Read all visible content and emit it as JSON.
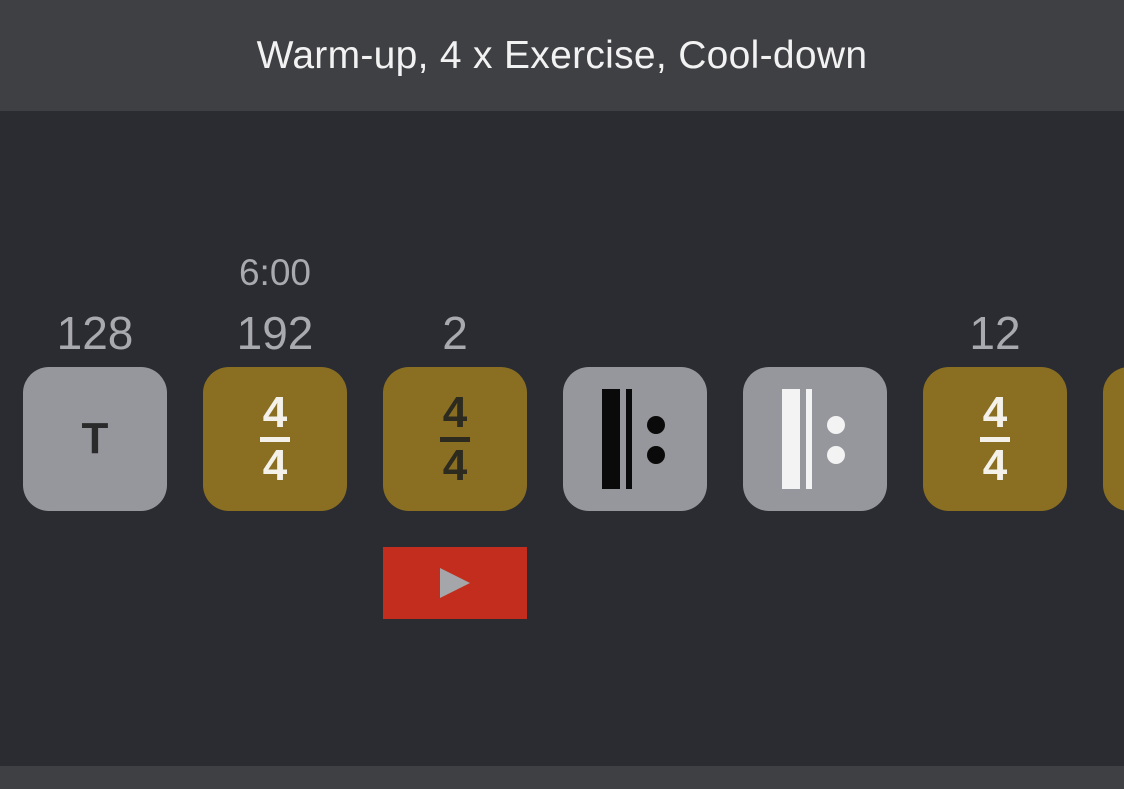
{
  "header": {
    "title": "Warm-up, 4 x Exercise, Cool-down"
  },
  "timeline": {
    "items": [
      {
        "label": "128",
        "type": "tempo",
        "symbol": "T"
      },
      {
        "label": "192",
        "time": "6:00",
        "type": "time-signature",
        "numerator": "4",
        "denominator": "4"
      },
      {
        "label": "2",
        "type": "time-signature",
        "numerator": "4",
        "denominator": "4"
      },
      {
        "label": "",
        "type": "repeat-start"
      },
      {
        "label": "",
        "type": "repeat-start"
      },
      {
        "label": "12",
        "type": "time-signature",
        "numerator": "4",
        "denominator": "4"
      }
    ]
  },
  "colors": {
    "background": "#2b2c31",
    "header": "#3f4044",
    "tile_grey": "#96979c",
    "tile_gold": "#8a6f22",
    "play": "#c22d1e"
  },
  "icons": {
    "play": "play-icon",
    "repeat": "repeat-start-icon"
  }
}
